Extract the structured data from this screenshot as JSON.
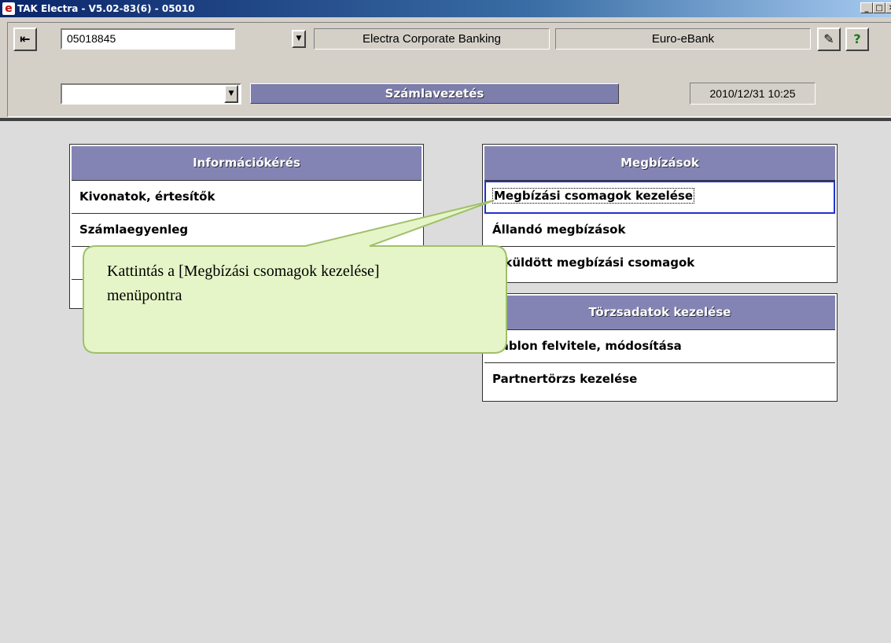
{
  "window": {
    "title": "TAK Electra - V5.02-83(6) - 05010",
    "app_icon_glyph": "e",
    "minimize_glyph": "_",
    "maximize_glyph": "□",
    "close_glyph": "✕"
  },
  "header": {
    "exit_icon_glyph": "⇤",
    "account_number": "05018845",
    "dropdown_glyph": "▼",
    "product_label": "Electra Corporate Banking",
    "bank_label": "Euro-eBank",
    "notes_icon_glyph": "✎",
    "help_book_icon_glyph": "?",
    "second_select_value": "",
    "section_title": "Számlavezetés",
    "datetime": "2010/12/31 10:25"
  },
  "panels": {
    "info": {
      "title": "Információkérés",
      "items": [
        "Kivonatok, értesítők",
        "Számlaegyenleg",
        "",
        ""
      ]
    },
    "orders": {
      "title": "Megbízások",
      "items": [
        "Megbízási csomagok kezelése",
        "Állandó megbízások",
        "Elküldött megbízási csomagok"
      ],
      "selected_index": 0
    },
    "master": {
      "title": "Törzsadatok kezelése",
      "items": [
        "Sablon felvitele, módosítása",
        "Partnertörzs kezelése"
      ]
    }
  },
  "callout": {
    "line1": "Kattintás a [Megbízási csomagok kezelése]",
    "line2": "menüpontra"
  },
  "colors": {
    "titlebar": "#0a246a",
    "panel_header": "#8484b4",
    "selection_outline": "#2233cc",
    "callout_fill": "#e6f5c8",
    "callout_border": "#9fc06a"
  }
}
